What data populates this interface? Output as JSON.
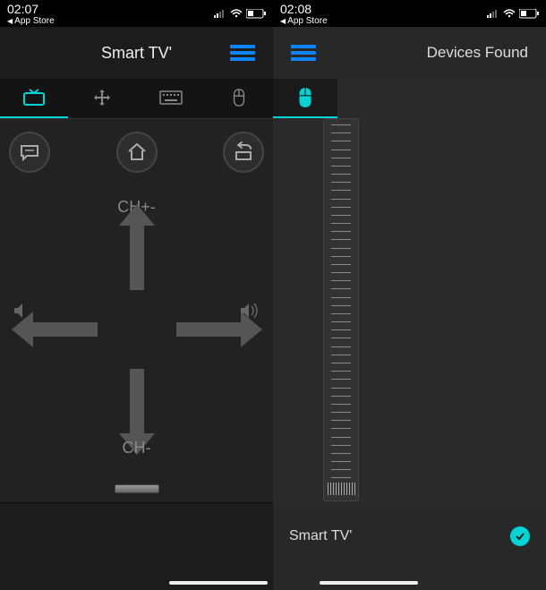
{
  "status": {
    "time_left": "02:07",
    "time_right": "02:08",
    "breadcrumb_left": "App Store",
    "breadcrumb_right": "App Store"
  },
  "screen1": {
    "title": "Smart TV'",
    "labels": {
      "ch_plus": "CH+-",
      "ch_minus": "CH-"
    }
  },
  "screen2": {
    "title": "Devices Found",
    "devices": [
      {
        "name": "Smart TV'",
        "selected": true
      }
    ]
  }
}
